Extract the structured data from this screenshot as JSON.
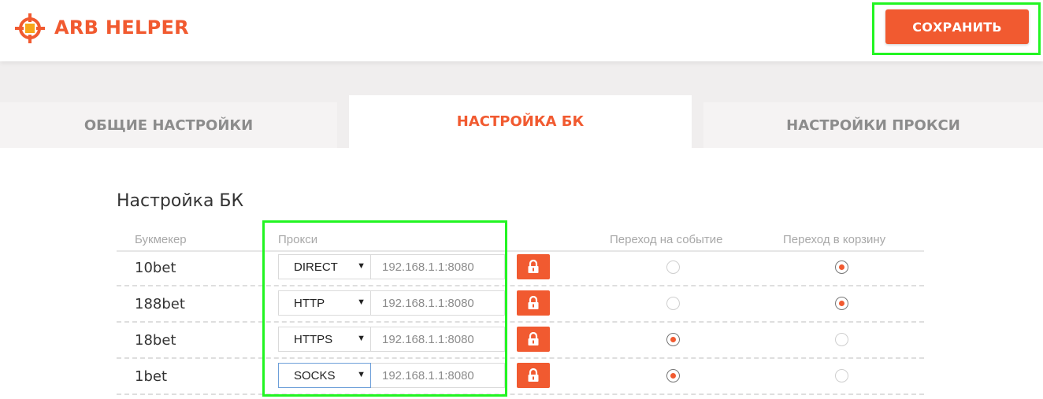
{
  "header": {
    "brand": "ARB HELPER",
    "save_label": "СОХРАНИТЬ"
  },
  "tabs": [
    {
      "label": "ОБЩИЕ НАСТРОЙКИ",
      "active": false
    },
    {
      "label": "НАСТРОЙКА БК",
      "active": true
    },
    {
      "label": "НАСТРОЙКИ ПРОКСИ",
      "active": false
    }
  ],
  "section": {
    "title": "Настройка БК",
    "columns": {
      "bookmaker": "Букмекер",
      "proxy": "Прокси",
      "event": "Переход на событие",
      "cart": "Переход в корзину"
    },
    "rows": [
      {
        "name": "10bet",
        "proxy_type": "DIRECT",
        "proxy_address": "192.168.1.1:8080",
        "event": false,
        "cart": true
      },
      {
        "name": "188bet",
        "proxy_type": "HTTP",
        "proxy_address": "192.168.1.1:8080",
        "event": false,
        "cart": true
      },
      {
        "name": "18bet",
        "proxy_type": "HTTPS",
        "proxy_address": "192.168.1.1:8080",
        "event": true,
        "cart": false
      },
      {
        "name": "1bet",
        "proxy_type": "SOCKS",
        "proxy_address": "192.168.1.1:8080",
        "event": true,
        "cart": false
      }
    ]
  },
  "colors": {
    "accent": "#f15a30",
    "highlight": "#22f522",
    "muted_text": "#a8a8a8"
  },
  "icons": {
    "logo": "crosshair-logo-icon",
    "lock": "lock-icon",
    "dropdown": "caret-down-icon"
  }
}
